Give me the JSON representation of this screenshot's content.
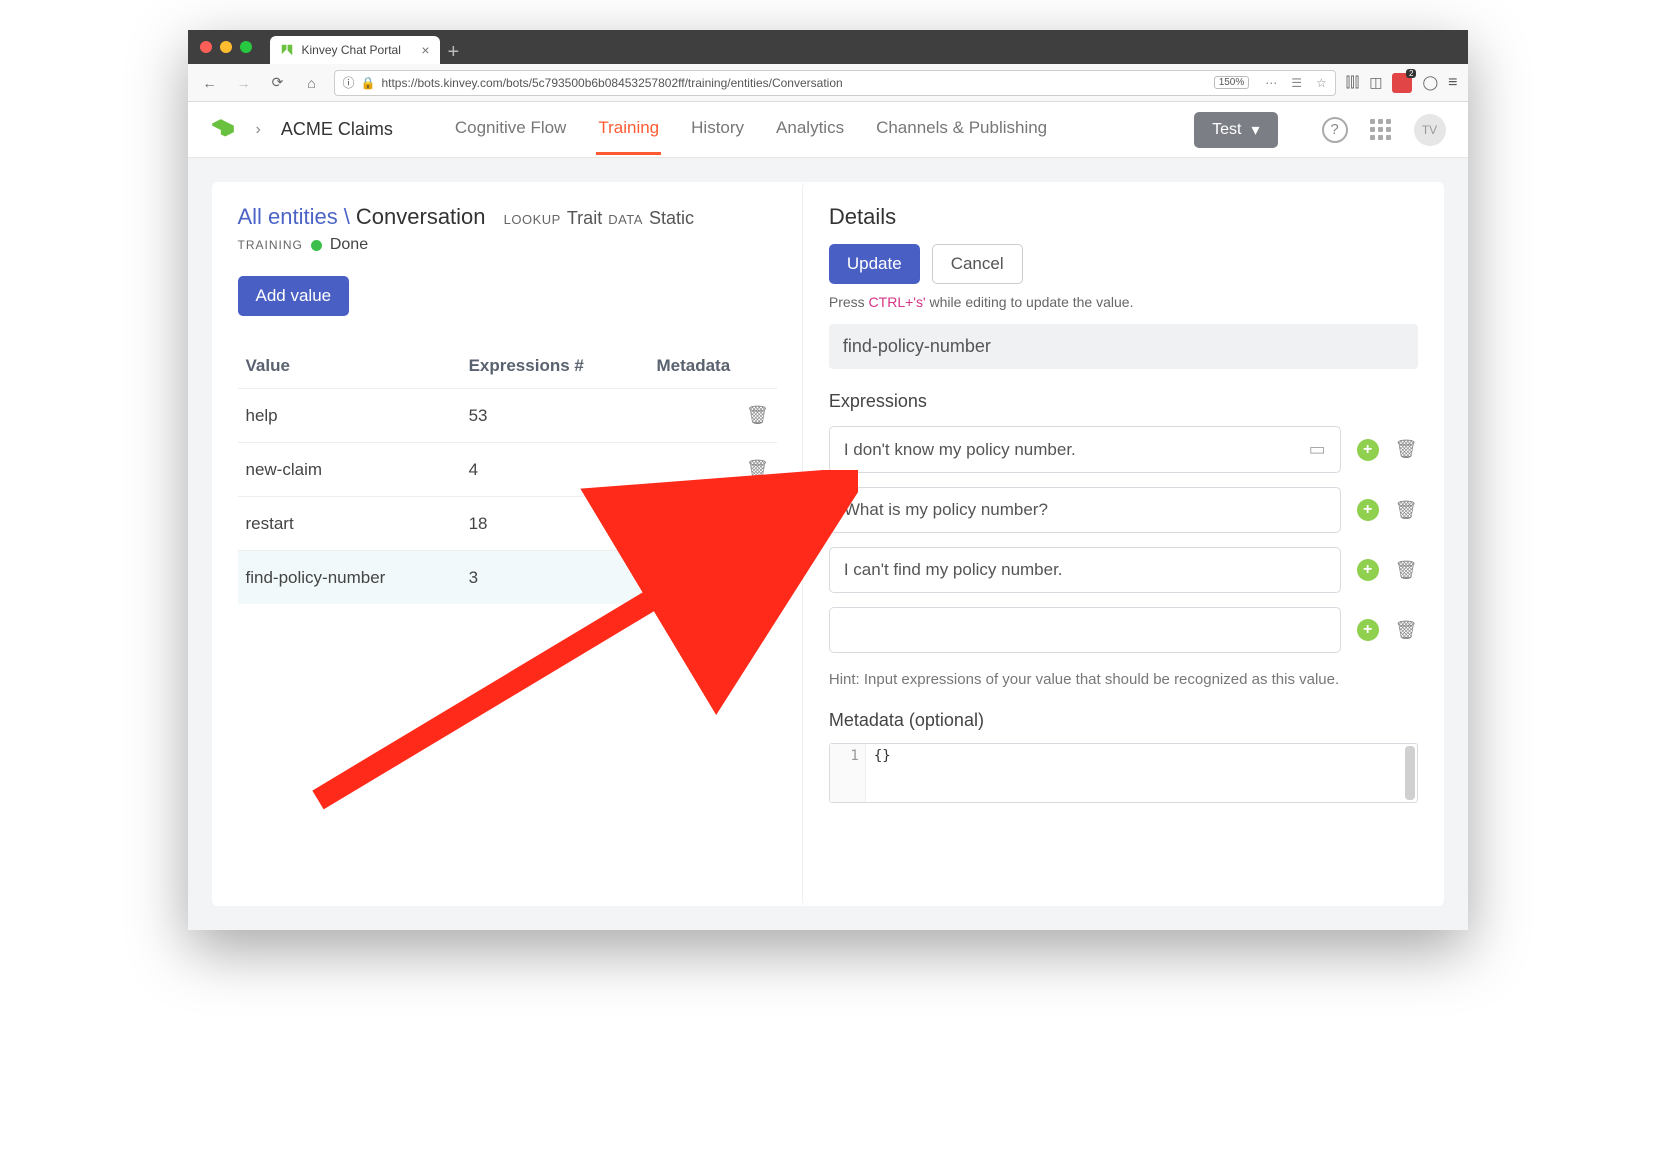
{
  "browser": {
    "tab_title": "Kinvey Chat Portal",
    "url": "https://bots.kinvey.com/bots/5c793500b6b08453257802ff/training/entities/Conversation",
    "zoom": "150%"
  },
  "header": {
    "brand": "ACME Claims",
    "nav": {
      "cognitive": "Cognitive Flow",
      "training": "Training",
      "history": "History",
      "analytics": "Analytics",
      "channels": "Channels & Publishing"
    },
    "test_button": "Test",
    "avatar": "TV"
  },
  "left": {
    "breadcrumb_link": "All entities",
    "breadcrumb_current": "Conversation",
    "lookup_label": "LOOKUP",
    "lookup_value": "Trait",
    "data_label": "DATA",
    "data_value": "Static",
    "training_label": "TRAINING",
    "training_status": "Done",
    "add_button": "Add value",
    "columns": {
      "value": "Value",
      "expr": "Expressions #",
      "meta": "Metadata"
    },
    "rows": [
      {
        "value": "help",
        "count": "53"
      },
      {
        "value": "new-claim",
        "count": "4"
      },
      {
        "value": "restart",
        "count": "18"
      },
      {
        "value": "find-policy-number",
        "count": "3"
      }
    ]
  },
  "right": {
    "title": "Details",
    "update": "Update",
    "cancel": "Cancel",
    "hint_pre": "Press ",
    "hint_kbd": "CTRL+'s'",
    "hint_post": " while editing to update the value.",
    "value_name": "find-policy-number",
    "expressions_label": "Expressions",
    "expressions": [
      "I don't know my policy number.",
      "What is my policy number?",
      "I can't find my policy number.",
      ""
    ],
    "expr_hint": "Hint: Input expressions of your value that should be recognized as this value.",
    "metadata_label": "Metadata (optional)",
    "metadata_line_no": "1",
    "metadata_code": "{}"
  }
}
